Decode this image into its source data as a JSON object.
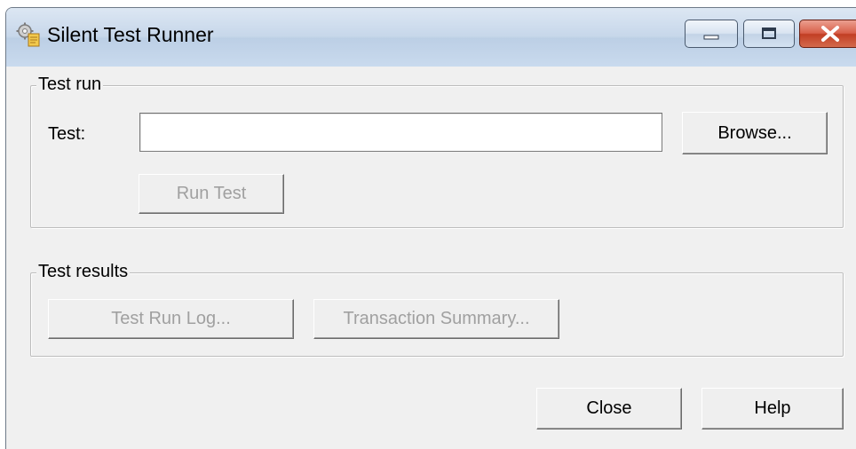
{
  "window": {
    "title": "Silent Test Runner",
    "icon": "gear-document-icon",
    "caption_buttons": {
      "minimize": "minimize-icon",
      "maximize": "maximize-icon",
      "close": "close-icon"
    }
  },
  "test_run": {
    "group_label": "Test run",
    "test_label": "Test:",
    "test_value": "",
    "browse_label": "Browse...",
    "run_label": "Run Test"
  },
  "test_results": {
    "group_label": "Test results",
    "log_label": "Test Run Log...",
    "summary_label": "Transaction Summary..."
  },
  "footer": {
    "close_label": "Close",
    "help_label": "Help"
  },
  "colors": {
    "title_bar": "#c7d7ea",
    "close_button": "#c74a2f",
    "dialog_background": "#f0f0f0",
    "disabled_text": "#a0a0a0"
  }
}
